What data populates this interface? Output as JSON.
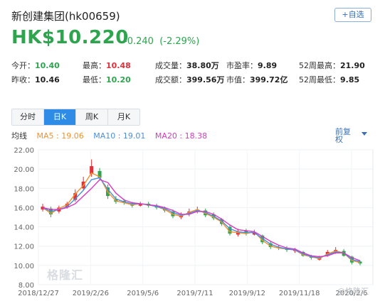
{
  "header": {
    "title": "新创建集团(hk00659)",
    "follow_label": "+自选",
    "price": "HK$10.220",
    "change": "-0.240",
    "change_pct": "(-2.29%)"
  },
  "stats": [
    [
      {
        "label": "今开：",
        "value": "10.40",
        "tone": "green"
      },
      {
        "label": "最高：",
        "value": "10.48",
        "tone": "red"
      },
      {
        "label": "成交量：",
        "value": "38.80万",
        "tone": "plain"
      },
      {
        "label": "市盈率：",
        "value": "9.89",
        "tone": "plain"
      },
      {
        "label": "52周最高：",
        "value": "21.90",
        "tone": "plain"
      }
    ],
    [
      {
        "label": "昨收：",
        "value": "10.46",
        "tone": "plain"
      },
      {
        "label": "最低：",
        "value": "10.20",
        "tone": "green"
      },
      {
        "label": "成交额：",
        "value": "399.56万",
        "tone": "plain"
      },
      {
        "label": "市值：",
        "value": "399.72亿",
        "tone": "plain"
      },
      {
        "label": "52周最低：",
        "value": "9.85",
        "tone": "plain"
      }
    ]
  ],
  "tabs": [
    {
      "label": "分时",
      "active": false
    },
    {
      "label": "日K",
      "active": true
    },
    {
      "label": "周K",
      "active": false
    },
    {
      "label": "月K",
      "active": false
    }
  ],
  "ma": {
    "label": "均线",
    "ma5": "MA5 : 19.06",
    "ma10": "MA10 : 19.01",
    "ma20": "MA20 : 18.38"
  },
  "adjust": {
    "line1": "前复",
    "line2": "权"
  },
  "colors": {
    "up": "#e0303a",
    "down": "#2ea44f",
    "ma5": "#f0922b",
    "ma10": "#4a8fdc",
    "ma20": "#d63ac0",
    "active_tab": "#2e8be6"
  },
  "watermark": "格隆汇",
  "watermark_corner": "@格隆汇",
  "chart_data": {
    "type": "line",
    "title": "",
    "ylim": [
      8,
      22
    ],
    "y_ticks": [
      "22.00",
      "20.00",
      "18.00",
      "16.00",
      "14.00",
      "12.00",
      "10.00",
      "8.00"
    ],
    "x_ticks": [
      "2018/12/27",
      "2019/2/26",
      "2019/5/6",
      "2019/7/11",
      "2019/9/12",
      "2019/11/18",
      "2020/2/6"
    ],
    "series": [
      {
        "name": "MA5",
        "values": [
          16.0,
          15.4,
          15.9,
          16.3,
          17.4,
          18.3,
          19.6,
          19.2,
          17.6,
          16.7,
          16.5,
          16.3,
          16.4,
          16.3,
          16.1,
          15.8,
          15.3,
          15.1,
          15.5,
          15.8,
          15.4,
          15.0,
          14.5,
          13.5,
          13.4,
          13.3,
          13.5,
          12.6,
          12.0,
          11.8,
          11.7,
          11.6,
          11.1,
          10.9,
          10.7,
          11.2,
          11.5,
          11.3,
          10.5,
          10.3
        ]
      },
      {
        "name": "MA10",
        "values": [
          16.0,
          15.6,
          15.8,
          16.1,
          16.9,
          17.8,
          18.9,
          19.1,
          17.9,
          16.9,
          16.6,
          16.4,
          16.4,
          16.3,
          16.1,
          15.9,
          15.5,
          15.2,
          15.4,
          15.7,
          15.5,
          15.1,
          14.6,
          13.8,
          13.5,
          13.4,
          13.4,
          12.8,
          12.2,
          11.9,
          11.7,
          11.6,
          11.2,
          10.9,
          10.8,
          11.1,
          11.4,
          11.3,
          10.6,
          10.4
        ]
      },
      {
        "name": "MA20",
        "values": [
          16.0,
          15.8,
          15.8,
          16.0,
          16.4,
          17.2,
          18.0,
          18.9,
          18.6,
          17.5,
          16.8,
          16.5,
          16.4,
          16.3,
          16.2,
          16.0,
          15.7,
          15.3,
          15.3,
          15.6,
          15.6,
          15.3,
          14.8,
          14.2,
          13.7,
          13.6,
          13.5,
          13.0,
          12.5,
          12.1,
          11.8,
          11.7,
          11.3,
          11.0,
          10.9,
          11.0,
          11.3,
          11.3,
          10.8,
          10.5
        ]
      }
    ],
    "candles": {
      "close": [
        16.1,
        15.3,
        16.0,
        16.4,
        17.5,
        18.7,
        20.3,
        19.1,
        17.2,
        16.6,
        16.5,
        16.2,
        16.4,
        16.2,
        16.0,
        15.7,
        15.1,
        15.2,
        15.6,
        15.8,
        15.2,
        14.9,
        14.3,
        13.3,
        13.5,
        13.3,
        13.4,
        12.4,
        11.9,
        11.8,
        11.6,
        11.6,
        11.0,
        10.8,
        10.8,
        11.4,
        11.6,
        11.0,
        10.3,
        10.2
      ],
      "open": [
        15.8,
        15.9,
        15.6,
        16.1,
        16.8,
        18.0,
        19.5,
        19.8,
        18.1,
        16.9,
        16.7,
        16.4,
        16.2,
        16.4,
        16.2,
        15.9,
        15.6,
        15.0,
        15.3,
        15.6,
        15.7,
        15.3,
        14.8,
        14.0,
        13.2,
        13.6,
        13.2,
        13.1,
        12.3,
        11.9,
        11.8,
        11.5,
        11.4,
        11.0,
        10.6,
        11.0,
        11.3,
        11.5,
        10.9,
        10.4
      ],
      "high": [
        16.4,
        16.1,
        16.2,
        16.6,
        17.9,
        19.2,
        21.0,
        20.1,
        18.4,
        17.2,
        16.9,
        16.6,
        16.6,
        16.6,
        16.4,
        16.1,
        15.8,
        15.5,
        15.9,
        16.1,
        15.9,
        15.5,
        14.9,
        14.2,
        13.8,
        13.8,
        13.7,
        13.2,
        12.5,
        12.1,
        12.0,
        11.8,
        11.5,
        11.1,
        11.0,
        11.6,
        11.9,
        11.7,
        11.0,
        10.5
      ],
      "low": [
        15.6,
        15.0,
        15.4,
        15.9,
        16.6,
        17.8,
        19.2,
        18.8,
        16.9,
        16.4,
        16.3,
        16.0,
        16.1,
        16.0,
        15.8,
        15.5,
        14.9,
        14.8,
        15.1,
        15.4,
        15.0,
        14.7,
        14.1,
        13.1,
        13.0,
        13.1,
        13.1,
        12.2,
        11.7,
        11.6,
        11.4,
        11.3,
        10.9,
        10.6,
        10.5,
        10.9,
        11.2,
        10.9,
        10.1,
        10.0
      ]
    }
  }
}
